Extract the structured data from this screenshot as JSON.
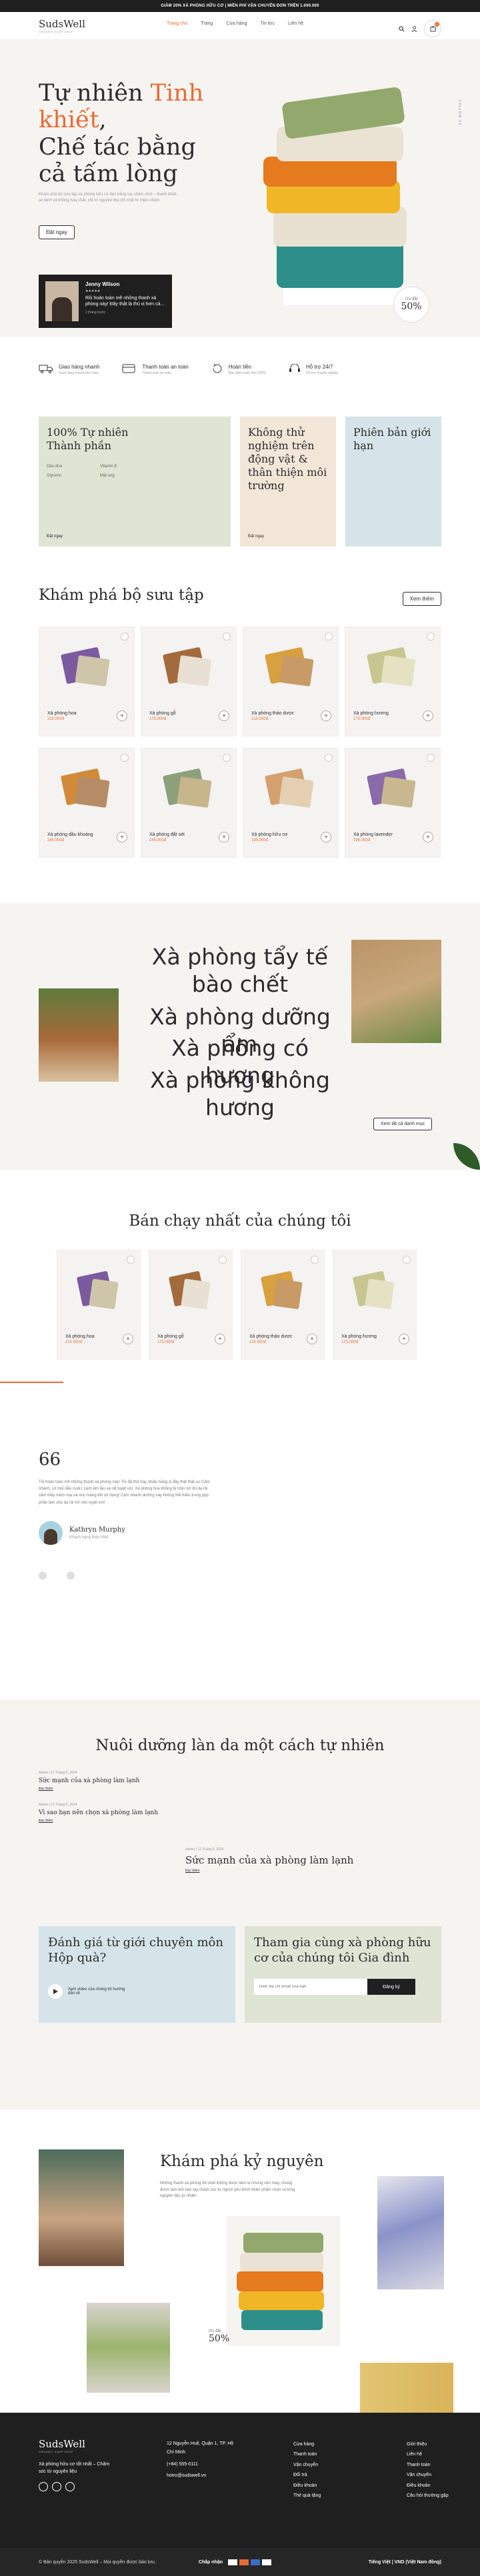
{
  "topbar": {
    "text": "GIẢM 20% XÀ PHÒNG HỮU CƠ | MIỄN PHÍ VẬN CHUYỂN ĐƠN TRÊN 1.000.000"
  },
  "header": {
    "logo": "SudsWell",
    "logo_sub": "ORGANIC SOAP SHOP",
    "nav": [
      "Trang chủ",
      "Trang",
      "Cửa hàng",
      "Tin tức",
      "Liên hệ"
    ],
    "cart_count": "0"
  },
  "hero": {
    "title_a": "Tự nhiên ",
    "title_hl": "Tinh khiết",
    "title_b": ",",
    "title_c": "Chế tác bằng cả tấm lòng",
    "desc": "Khám phá bộ sưu tập xà phòng hữu cơ làm bằng tay chăm chút – thanh khiết, an lành và không hóa chất, chỉ từ nguyên liệu tốt nhất từ thiên nhiên.",
    "cta": "Đặt ngay",
    "vertical": "FOLLOW US",
    "badge_top": "Ưu đãi",
    "badge_val": "50%"
  },
  "review": {
    "name": "Jenny Wilson",
    "stars": "★★★★★",
    "quote": "Rồi hoàn toàn mê những thanh xà phòng này! Đây thật là thú vị hơn cả...",
    "time": "1 tháng trước"
  },
  "features": [
    {
      "title": "Giao hàng nhanh",
      "sub": "Giao hàng nhanh trên toàn"
    },
    {
      "title": "Thanh toán an toàn",
      "sub": "Thanh toán an toàn"
    },
    {
      "title": "Hoàn tiền",
      "sub": "Bảo đảm hoàn tiền 100%"
    },
    {
      "title": "Hỗ trợ 24/7",
      "sub": "Hỗ trợ chuyên nghiệp"
    }
  ],
  "cards": [
    {
      "title": "100% Tự nhiên Thành phần",
      "tags": [
        "Dầu dừa",
        "Vitamin E",
        "Glycerin",
        "Mật ong"
      ],
      "link": "Đặt ngay",
      "color": "#dfe4d5"
    },
    {
      "title": "Không thử nghiệm trên động vật & thân thiện môi trường",
      "link": "Đặt ngay",
      "color": "#f2e6d9"
    },
    {
      "title": "Phiên bản giới hạn",
      "link": "",
      "color": "#d6e4ea"
    }
  ],
  "collection": {
    "title": "Khám phá bộ sưu tập",
    "viewall": "Xem thêm",
    "products": [
      {
        "name": "Xà phòng hoa",
        "price": "215.000đ",
        "c1": "#7b5aa0",
        "c2": "#cfc5a8"
      },
      {
        "name": "Xà phòng gỗ",
        "price": "175.000đ",
        "c1": "#a36b3c",
        "c2": "#e8e0d2"
      },
      {
        "name": "Xà phòng thảo dược",
        "price": "215.000đ",
        "c1": "#d9a040",
        "c2": "#c89a65"
      },
      {
        "name": "Xà phòng hương",
        "price": "175.000đ",
        "c1": "#c8c690",
        "c2": "#e5e2c4"
      },
      {
        "name": "Xà phòng dầu khoáng",
        "price": "245.000đ",
        "c1": "#d08a3a",
        "c2": "#b58c65"
      },
      {
        "name": "Xà phòng đất sét",
        "price": "245.000đ",
        "c1": "#8da07a",
        "c2": "#c7b58b"
      },
      {
        "name": "Xà phòng hữu cơ",
        "price": "195.000đ",
        "c1": "#d4a070",
        "c2": "#e5cfb2"
      },
      {
        "name": "Xà phòng lavender",
        "price": "195.000đ",
        "c1": "#8a6aa8",
        "c2": "#c9b88f"
      }
    ]
  },
  "categories": {
    "lines": [
      "Xà phòng tẩy tế bào chết",
      "Xà phòng dưỡng ẩm",
      "Xà phòng có hương",
      "Xà phòng không hương"
    ],
    "btn": "Xem tất cả danh mục"
  },
  "bestsellers": {
    "title": "Bán chạy nhất của chúng tôi",
    "items": [
      {
        "name": "Xà phòng hoa",
        "price": "215.000đ",
        "c1": "#7b5aa0",
        "c2": "#cfc5a8"
      },
      {
        "name": "Xà phòng gỗ",
        "price": "175.000đ",
        "c1": "#a36b3c",
        "c2": "#e8e0d2"
      },
      {
        "name": "Xà phòng thảo dược",
        "price": "215.000đ",
        "c1": "#d9a040",
        "c2": "#c89a65"
      },
      {
        "name": "Xà phòng hương",
        "price": "175.000đ",
        "c1": "#c8c690",
        "c2": "#e5e2c4"
      }
    ]
  },
  "testimonial": {
    "mark": "66",
    "text": "Tôi hoàn toàn mê những thanh xà phòng này! Tôi đã thử hay nhiều hãng & đây thật thật sự Cảm nhanh, có mùi dễu nuôi1 cách êm lâu và rất tuyệt vời. Xà phòng hoa không bị mòn nữ tới da tôi cảm thấy mềm mại và mịn màng khi sử dụng! Cảm nhanh dưỡng này không thể thiếu trong góp phần làm cho da tôi trở nên tuyệt vời!",
    "name": "Kathryn Murphy",
    "role": "Khách hàng thân thiết"
  },
  "blog": {
    "title": "Nuôi dưỡng làn da một cách tự nhiên",
    "posts": [
      {
        "meta": "Admin | 12 Tháng 8, 2024",
        "title": "Sức mạnh của xà phòng làm lạnh",
        "read": "Đọc thêm"
      },
      {
        "meta": "Admin | 12 Tháng 8, 2024",
        "title": "Vì sao bạn nên chọn xà phòng làm lạnh",
        "read": "Đọc thêm"
      },
      {
        "meta": "Admin | 12 Tháng 8, 2024",
        "title": "Sức mạnh của xà phòng làm lạnh",
        "read": "Đọc thêm"
      }
    ]
  },
  "cta": {
    "quiz_title": "Đánh giá từ giới chuyên môn Hộp quà?",
    "quiz_sub": "Xem video của chúng tôi hướng dẫn về",
    "family_title": "Tham gia cùng xà phòng hữu cơ của chúng tôi Gia đình",
    "email_ph": "Điền địa chỉ email của bạn",
    "subscribe": "Đăng ký"
  },
  "explore": {
    "title": "Khám phá kỷ nguyên",
    "desc": "Những thanh xà phòng tốt nhất không được làm ra nhưng nên may, chúng được làm bởi bàn tay chăm sóc từ người yêu thích thiên nhiên chọn ra từng nguyên liệu tự nhiên.",
    "badge_top": "Ưu đãi",
    "badge_val": "50%"
  },
  "footer": {
    "logo": "SudsWell",
    "logo_sub": "ORGANIC SOAP SHOP",
    "tag": "Xà phòng hữu cơ tốt nhất – Chăm sóc từ nguyên liệu",
    "address": "12 Nguyễn Huệ, Quận 1, TP. Hồ Chí Minh",
    "phone": "(+84) 555-0111",
    "email": "hotro@sudswell.vn",
    "links1": [
      "Cửa hàng",
      "Thanh toán",
      "Vận chuyển",
      "Đổi trả",
      "Điều khoản",
      "Thẻ quà tặng"
    ],
    "links2": [
      "Giới thiệu",
      "Liên hệ",
      "Thanh toán",
      "Vận chuyển",
      "Điều khoản",
      "Câu hỏi thường gặp"
    ],
    "copyright": "© Bản quyền 2025 SudsWell – Mọi quyền được bảo lưu.",
    "pay_label": "Chấp nhận",
    "lang": "Tiếng Việt | VND (Việt Nam đồng)"
  }
}
